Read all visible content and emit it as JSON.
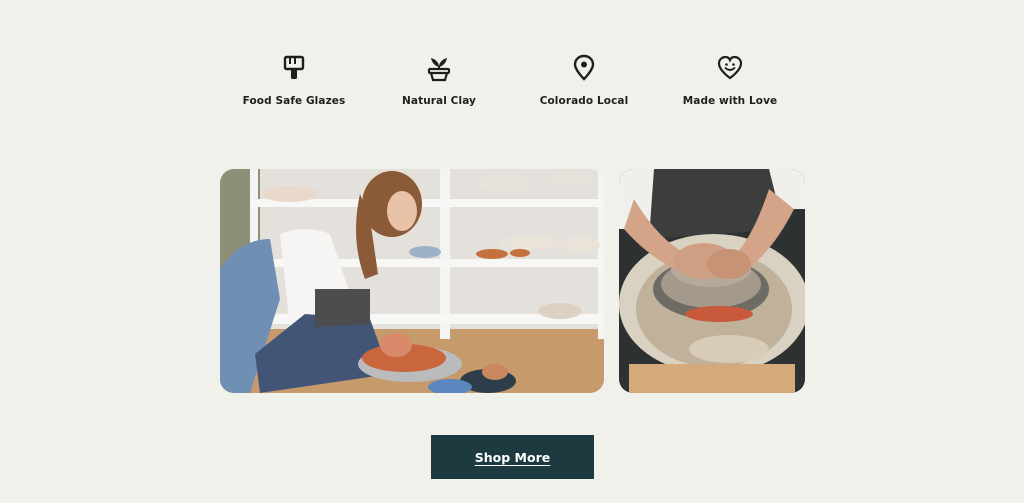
{
  "features": [
    {
      "label": "Food Safe Glazes",
      "icon": "paint-brush-icon"
    },
    {
      "label": "Natural Clay",
      "icon": "sprout-pot-icon"
    },
    {
      "label": "Colorado Local",
      "icon": "map-pin-icon"
    },
    {
      "label": "Made with Love",
      "icon": "smiling-heart-icon"
    }
  ],
  "photos": [
    {
      "subject": "woman-at-pottery-wheel"
    },
    {
      "subject": "hands-shaping-clay-on-wheel"
    }
  ],
  "cta": {
    "label": "Shop More"
  },
  "colors": {
    "background": "#f1f1ec",
    "button": "#1d3a40",
    "button_text": "#ffffff",
    "icon": "#1e1e1e"
  }
}
